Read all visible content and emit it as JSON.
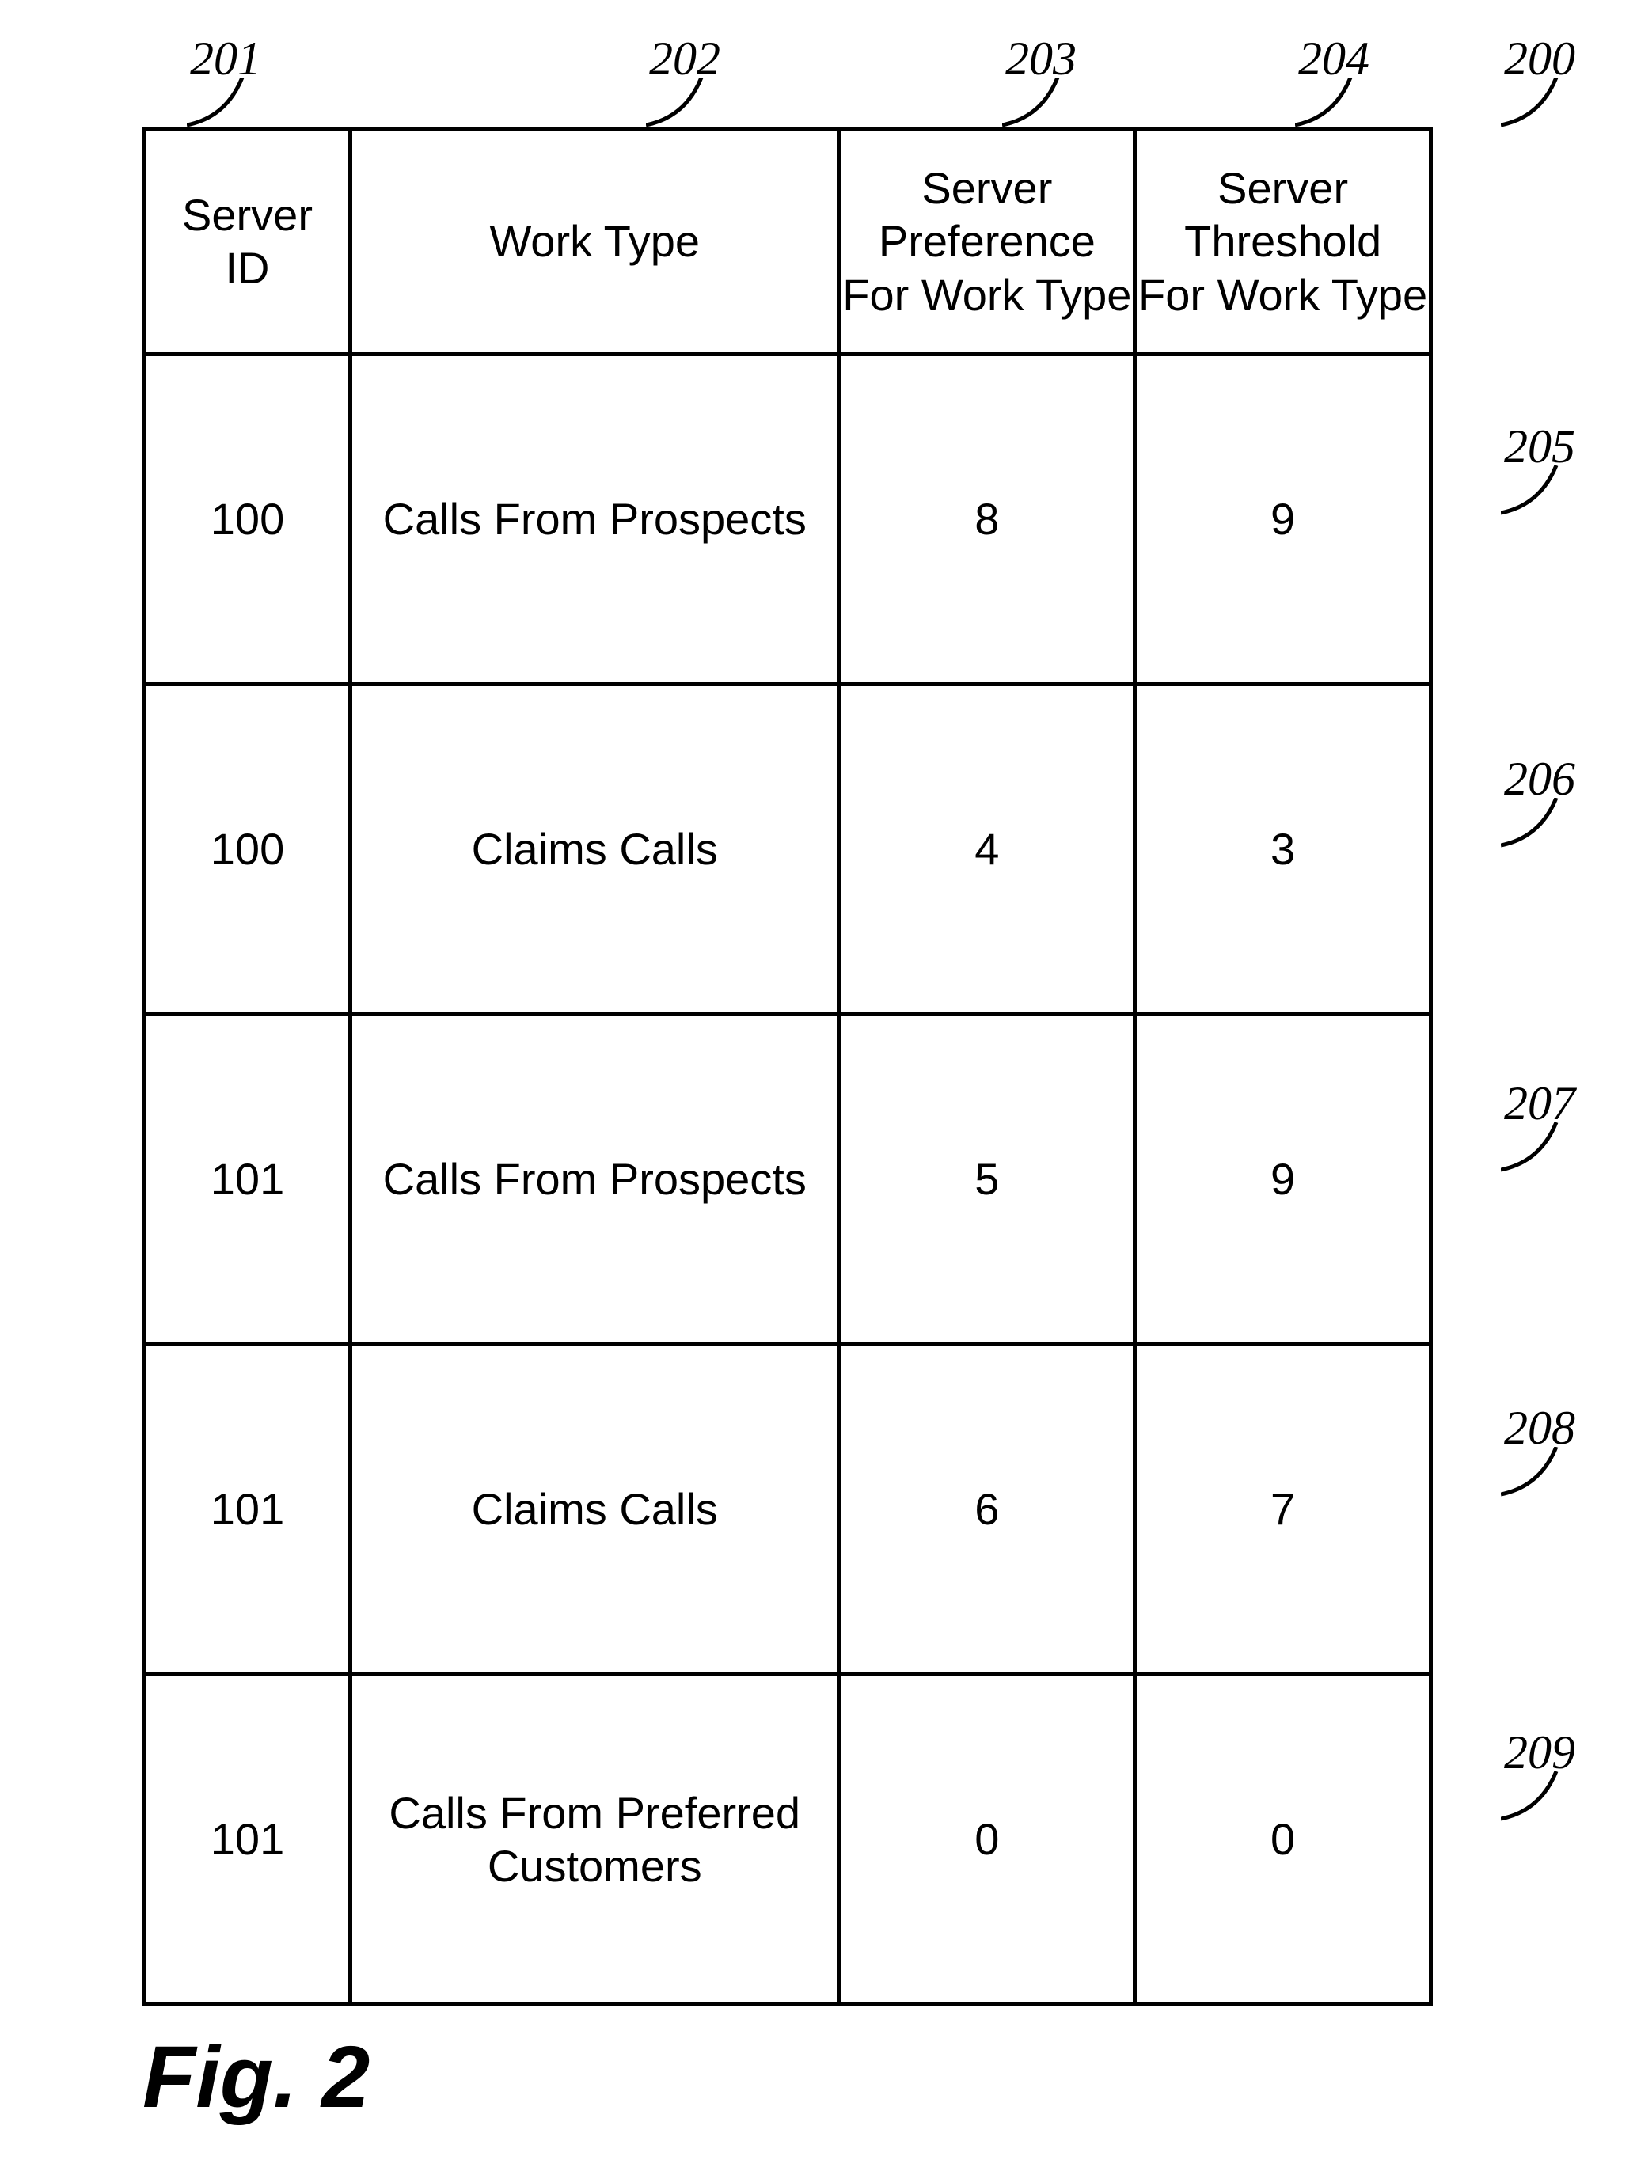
{
  "figure_caption": "Fig. 2",
  "table_ref": "200",
  "columns": [
    {
      "ref": "201",
      "label": "Server\nID"
    },
    {
      "ref": "202",
      "label": "Work Type"
    },
    {
      "ref": "203",
      "label": "Server Preference\nFor Work Type"
    },
    {
      "ref": "204",
      "label": "Server Threshold\nFor Work Type"
    }
  ],
  "rows": [
    {
      "ref": "205",
      "server_id": "100",
      "work_type": "Calls From Prospects",
      "preference": "8",
      "threshold": "9"
    },
    {
      "ref": "206",
      "server_id": "100",
      "work_type": "Claims Calls",
      "preference": "4",
      "threshold": "3"
    },
    {
      "ref": "207",
      "server_id": "101",
      "work_type": "Calls From Prospects",
      "preference": "5",
      "threshold": "9"
    },
    {
      "ref": "208",
      "server_id": "101",
      "work_type": "Claims Calls",
      "preference": "6",
      "threshold": "7"
    },
    {
      "ref": "209",
      "server_id": "101",
      "work_type": "Calls From Preferred\nCustomers",
      "preference": "0",
      "threshold": "0"
    }
  ]
}
